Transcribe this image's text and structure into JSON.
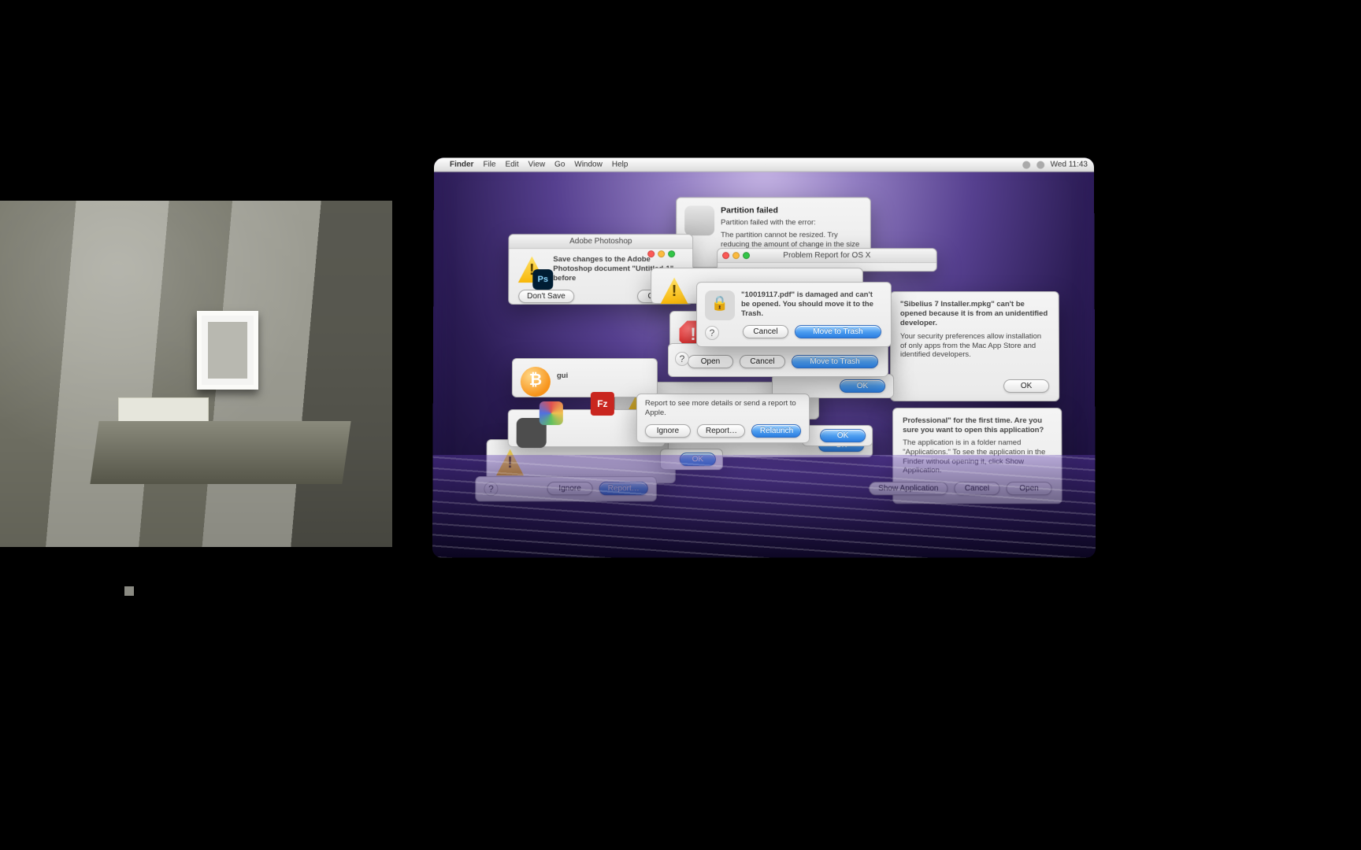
{
  "menubar": {
    "app": "Finder",
    "items": [
      "File",
      "Edit",
      "View",
      "Go",
      "Window",
      "Help"
    ],
    "clock": "Wed 11:43"
  },
  "dialogs": {
    "partition": {
      "title": "Partition failed",
      "line1": "Partition failed with the error:",
      "line2": "The partition cannot be resized. Try reducing the amount of change in the size of the partition"
    },
    "problem_report": {
      "titlebar": "Problem Report for OS X"
    },
    "photoshop": {
      "titlebar": "Adobe Photoshop",
      "text": "Save changes to the Adobe Photoshop document \"Untitled-1\" before",
      "dont_save": "Don't Save",
      "cancel": "Cancel"
    },
    "damaged": {
      "text": "\"10019117.pdf\" is damaged and can't be opened. You should move it to the Trash.",
      "cancel": "Cancel",
      "move": "Move to Trash"
    },
    "damaged2": {
      "open": "Open",
      "cancel": "Cancel",
      "move": "Move to Trash"
    },
    "unidentified": {
      "text": "\"Sibelius 7 Installer.mpkg\" can't be opened because it is from an unidentified developer.",
      "body": "Your security preferences allow installation of only apps from the Mac App Store and identified developers.",
      "ok": "OK"
    },
    "first_time": {
      "text": "Professional\" for the first time. Are you sure you want to open this application?",
      "body": "The application is in a folder named \"Applications.\" To see the application in the Finder without opening it, click Show Application.",
      "show": "Show Application",
      "cancel": "Cancel",
      "open": "Open"
    },
    "crash": {
      "text": "Report to see more details or send a report to Apple.",
      "ignore": "Ignore",
      "report": "Report…",
      "relaunch": "Relaunch"
    },
    "ok_only": {
      "ok": "OK"
    },
    "report_only": {
      "ignore": "Ignore",
      "report": "Report…"
    },
    "gui_label": "gui",
    "help": "?"
  }
}
